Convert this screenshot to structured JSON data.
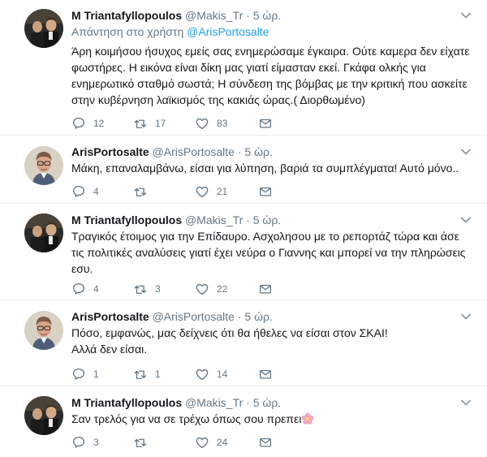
{
  "tweets": [
    {
      "name": "M Triantafyllopoulos",
      "handle": "@Makis_Tr",
      "dot": "·",
      "time": "5 ώρ.",
      "reply_prefix": "Απάντηση στο χρήστη",
      "reply_user": "@ArisPortosalte",
      "text": "Άρη κοιμήσου ήσυχος εμείς σας ενημερώσαμε έγκαιρα. Ούτε καμερα δεν είχατε φωστήρες. Η εικόνα είναι δίκη μας γιατί είμασταν εκεί. Γκάφα ολκής για ενημερωτικό σταθμό σωστά; Η σύνδεση της βόμβας με την κριτική που ασκείτε στην κυβέρνηση λαϊκισμός της κακιάς ώρας.( Διορθωμένο)",
      "replies": "12",
      "retweets": "17",
      "likes": "83"
    },
    {
      "name": "ArisPortosalte",
      "handle": "@ArisPortosalte",
      "dot": "·",
      "time": "5 ώρ.",
      "text": "Μάκη, επαναλαμβάνω, είσαι για λύπηση, βαριά τα συμπλέγματα! Αυτό μόνο..",
      "replies": "4",
      "retweets": "",
      "likes": "21"
    },
    {
      "name": "M Triantafyllopoulos",
      "handle": "@Makis_Tr",
      "dot": "·",
      "time": "5 ώρ.",
      "text": "Τραγικός έτοιμος για την Επίδαυρο. Ασχολησου με το ρεπορτάζ τώρα και άσε τις πολιτικές αναλύσεις γιατί έχει νεύρα ο Γιαννης και μπορεί να την πληρώσεις εσυ.",
      "replies": "4",
      "retweets": "3",
      "likes": "22"
    },
    {
      "name": "ArisPortosalte",
      "handle": "@ArisPortosalte",
      "dot": "·",
      "time": "5 ώρ.",
      "text_line1": "Πόσο, εμφανώς, μας δείχνεις ότι θα ήθελες να είσαι στον ΣΚΑΙ!",
      "text_line2": "Αλλά δεν είσαι.",
      "replies": "1",
      "retweets": "1",
      "likes": "14"
    },
    {
      "name": "M Triantafyllopoulos",
      "handle": "@Makis_Tr",
      "dot": "·",
      "time": "5 ώρ.",
      "text": "Σαν τρελός για να σε τρέχω όπως σου πρεπει",
      "emoji_icon": "blossom-emoji-icon",
      "replies": "3",
      "retweets": "",
      "likes": "24"
    }
  ],
  "colors": {
    "link": "#1da1f2",
    "muted": "#657786",
    "text": "#14171a",
    "divider": "#e6ecf0"
  }
}
